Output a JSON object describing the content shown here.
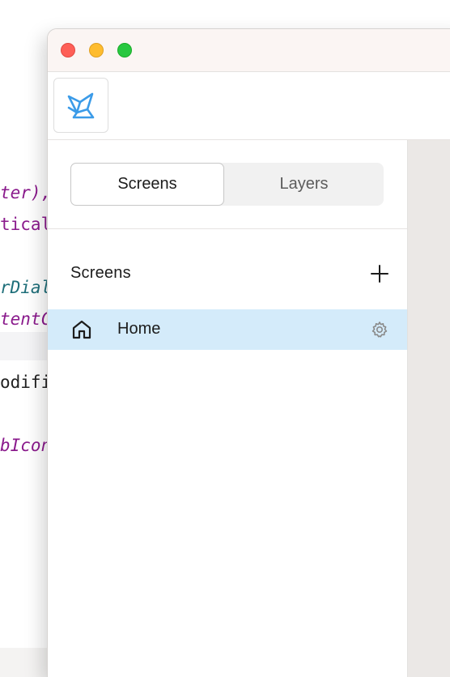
{
  "editor": {
    "lines": [
      {
        "text": "ter),",
        "style": "purple-mixed"
      },
      {
        "text": "tical",
        "style": "purple"
      },
      {
        "text": "rDial",
        "style": "teal"
      },
      {
        "text": "tentC",
        "style": "purple"
      },
      {
        "text": "odifi",
        "style": "black"
      },
      {
        "text": "bIcon",
        "style": "purple"
      }
    ]
  },
  "window": {
    "traffic_lights": [
      "close",
      "minimize",
      "zoom"
    ],
    "logo_icon": "app-logo-icon"
  },
  "sidebar": {
    "tabs": [
      {
        "label": "Screens",
        "active": true
      },
      {
        "label": "Layers",
        "active": false
      }
    ],
    "section_title": "Screens",
    "add_icon": "plus-icon",
    "screens": [
      {
        "label": "Home",
        "icon": "home-icon",
        "selected": true,
        "settings_icon": "gear-icon"
      }
    ]
  },
  "colors": {
    "accent_selection": "#d4ebfa",
    "logo_blue": "#3b9be8"
  }
}
